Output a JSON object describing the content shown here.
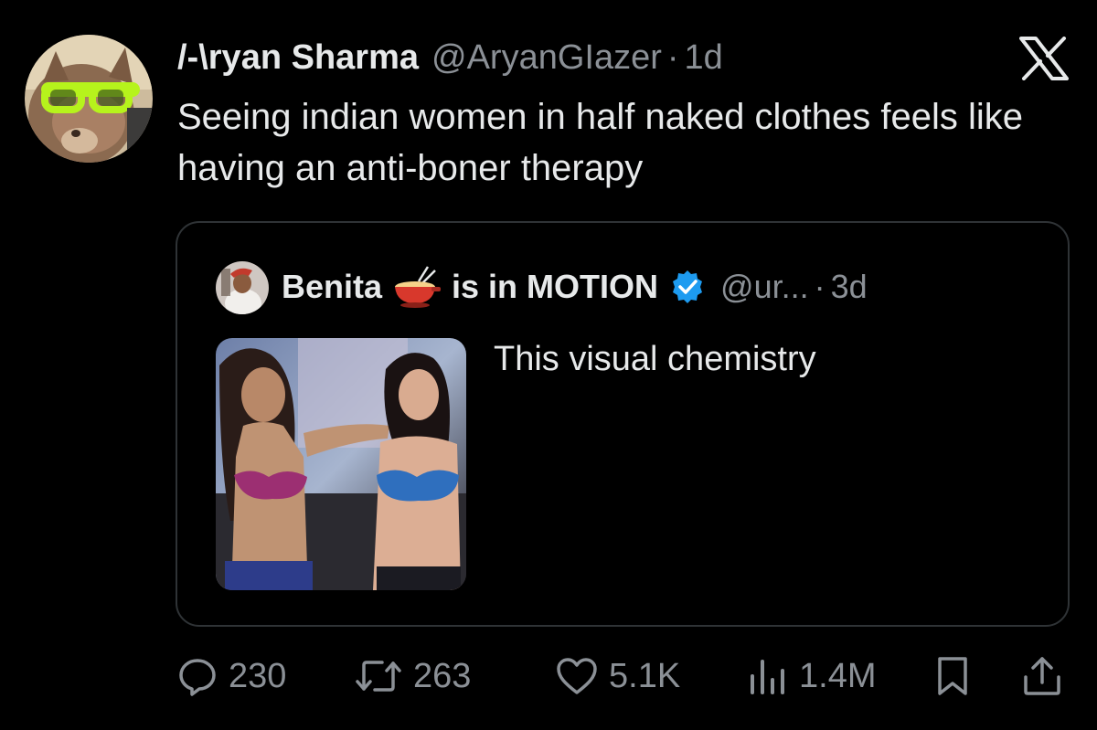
{
  "tweet": {
    "author": {
      "display_name": "/-\\ryan Sharma",
      "handle": "@AryanGIazer",
      "separator": "·",
      "time": "1d",
      "avatar_icon": "cat-with-glasses-avatar"
    },
    "text": "Seeing indian women in half naked clothes feels like having an anti-boner therapy",
    "platform_icon": "x-logo-icon"
  },
  "quote": {
    "author": {
      "name_part1": "Benita",
      "name_emoji_icon": "fondue-icon",
      "name_part2": "is in MOTION",
      "verified_icon": "verified-badge-icon",
      "handle": "@ur...",
      "separator": "·",
      "time": "3d"
    },
    "text": "This visual chemistry",
    "media_icon": "photo-thumbnail"
  },
  "actions": {
    "replies": "230",
    "reposts": "263",
    "likes": "5.1K",
    "views": "1.4M"
  },
  "colors": {
    "background": "#000000",
    "text_primary": "#e7e9ea",
    "text_secondary": "#8b9096",
    "border": "#2f3336",
    "verified": "#1d9bf0"
  }
}
